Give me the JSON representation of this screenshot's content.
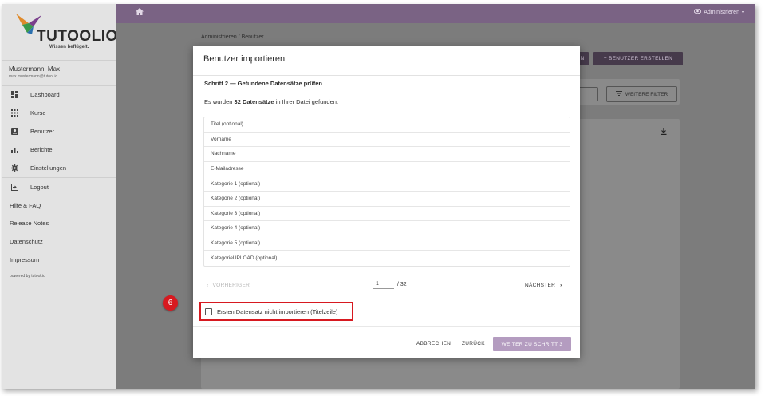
{
  "colors": {
    "topbar": "#7a6384",
    "primary_button": "#b49cc0",
    "highlight_red": "#d71920",
    "sidebar": "#e3e3e3"
  },
  "brand": {
    "logo_text": "TUTOOLIO",
    "tagline": "Wissen beflügelt."
  },
  "user": {
    "name": "Mustermann, Max",
    "email": "max.mustermann@tutool.io"
  },
  "sidebar": {
    "items": [
      {
        "label": "Dashboard",
        "icon": "dashboard-icon"
      },
      {
        "label": "Kurse",
        "icon": "grid-icon"
      },
      {
        "label": "Benutzer",
        "icon": "user-box-icon"
      },
      {
        "label": "Berichte",
        "icon": "bar-chart-icon"
      },
      {
        "label": "Einstellungen",
        "icon": "gear-icon"
      },
      {
        "label": "Logout",
        "icon": "logout-icon"
      }
    ],
    "links": [
      "Hilfe & FAQ",
      "Release Notes",
      "Datenschutz",
      "Impressum"
    ],
    "powered": "powered by tutool.io"
  },
  "topbar": {
    "home_icon": "home-icon",
    "admin_label": "Administrieren",
    "admin_icon": "eye-icon"
  },
  "background": {
    "breadcrumb": "Administrieren / Benutzer",
    "import_button_fragment": "N",
    "create_button": "+ BENUTZER ERSTELLEN",
    "filter_button": "WEITERE FILTER"
  },
  "modal": {
    "title": "Benutzer importieren",
    "step_title": "Schritt 2 — Gefundene Datensätze prüfen",
    "found_prefix": "Es wurden ",
    "found_count": "32 Datensätze",
    "found_suffix": " in Ihrer Datei gefunden.",
    "fields": [
      "Titel (optional)",
      "Vorname",
      "Nachname",
      "E-Mailadresse",
      "Kategorie 1 (optional)",
      "Kategorie 2 (optional)",
      "Kategorie 3 (optional)",
      "Kategorie 4 (optional)",
      "Kategorie 5 (optional)",
      "KategorieUPLOAD (optional)"
    ],
    "pager": {
      "prev": "VORHERIGER",
      "page": "1",
      "total": "/ 32",
      "next": "NÄCHSTER"
    },
    "checkbox_label": "Ersten Datensatz nicht importieren (Titelzeile)",
    "buttons": {
      "cancel": "ABBRECHEN",
      "back": "ZURÜCK",
      "next": "WEITER ZU SCHRITT 3"
    }
  },
  "callout": "6"
}
